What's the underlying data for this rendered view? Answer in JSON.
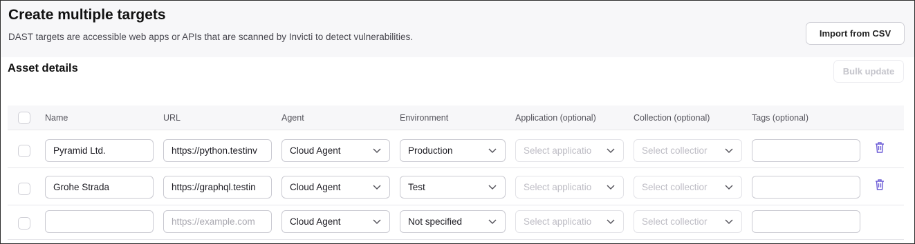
{
  "header": {
    "title": "Create multiple targets",
    "subtitle": "DAST targets are accessible web apps or APIs that are scanned by Invicti to detect vulnerabilities.",
    "import_button": "Import from CSV"
  },
  "section": {
    "title": "Asset details",
    "bulk_update_button": "Bulk update"
  },
  "table": {
    "columns": [
      "Name",
      "URL",
      "Agent",
      "Environment",
      "Application (optional)",
      "Collection (optional)",
      "Tags (optional)"
    ],
    "rows": [
      {
        "name": "Pyramid Ltd.",
        "url": "https://python.testinv",
        "agent": "Cloud Agent",
        "environment": "Production",
        "application_placeholder": "Select applicatio",
        "collection_placeholder": "Select collectior",
        "tags": ""
      },
      {
        "name": "Grohe Strada",
        "url": "https://graphql.testin",
        "agent": "Cloud Agent",
        "environment": "Test",
        "application_placeholder": "Select applicatio",
        "collection_placeholder": "Select collectior",
        "tags": ""
      },
      {
        "name": "",
        "url_placeholder": "https://example.com",
        "agent": "Cloud Agent",
        "environment": "Not specified",
        "application_placeholder": "Select applicatio",
        "collection_placeholder": "Select collectior",
        "tags": ""
      }
    ]
  },
  "colors": {
    "accent": "#6b5bd6",
    "header_bg": "#f7f7f9",
    "border": "#c9c9d1"
  },
  "icons": {
    "delete": "trash-icon",
    "dropdown": "chevron-down-icon"
  }
}
